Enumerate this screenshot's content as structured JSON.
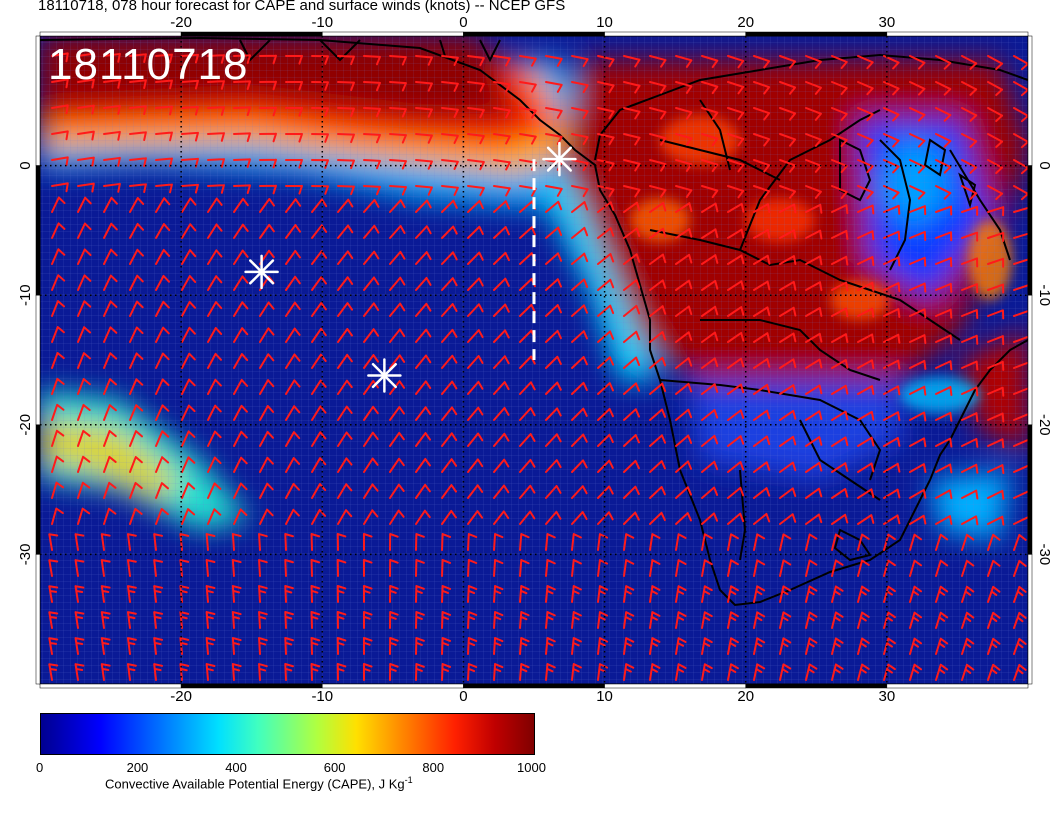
{
  "title": "18110718, 078 hour forecast for CAPE and surface winds (knots) -- NCEP GFS",
  "stamp": "18110718",
  "colors": {
    "ocean_low": "#0a1a96",
    "high_cape": "#8a0000",
    "land_border": "#000000",
    "barb": "#ff1a1a",
    "marker": "#ffffff"
  },
  "map": {
    "lon_range": [
      -30,
      40
    ],
    "lat_range": [
      -40,
      10
    ],
    "lon_ticks": [
      "-20",
      "-10",
      "0",
      "10",
      "20",
      "30"
    ],
    "lat_ticks": [
      "0",
      "-10",
      "-20",
      "-30"
    ],
    "graticule": "dotted, 10 degrees"
  },
  "markers": [
    {
      "name": "star-marker-east",
      "lon": 6.8,
      "lat": 0.5
    },
    {
      "name": "star-marker-west",
      "lon": -14.3,
      "lat": -8.2
    },
    {
      "name": "star-marker-south",
      "lon": -5.6,
      "lat": -16.2
    }
  ],
  "dashed_line": {
    "lon": 5,
    "lat_from": 0.5,
    "lat_to": -15
  },
  "colorbar": {
    "ticks": [
      "0",
      "200",
      "400",
      "600",
      "800",
      "1000"
    ],
    "label_main": "Convective Available Potential Energy (CAPE), J Kg",
    "label_sup": "-1"
  }
}
